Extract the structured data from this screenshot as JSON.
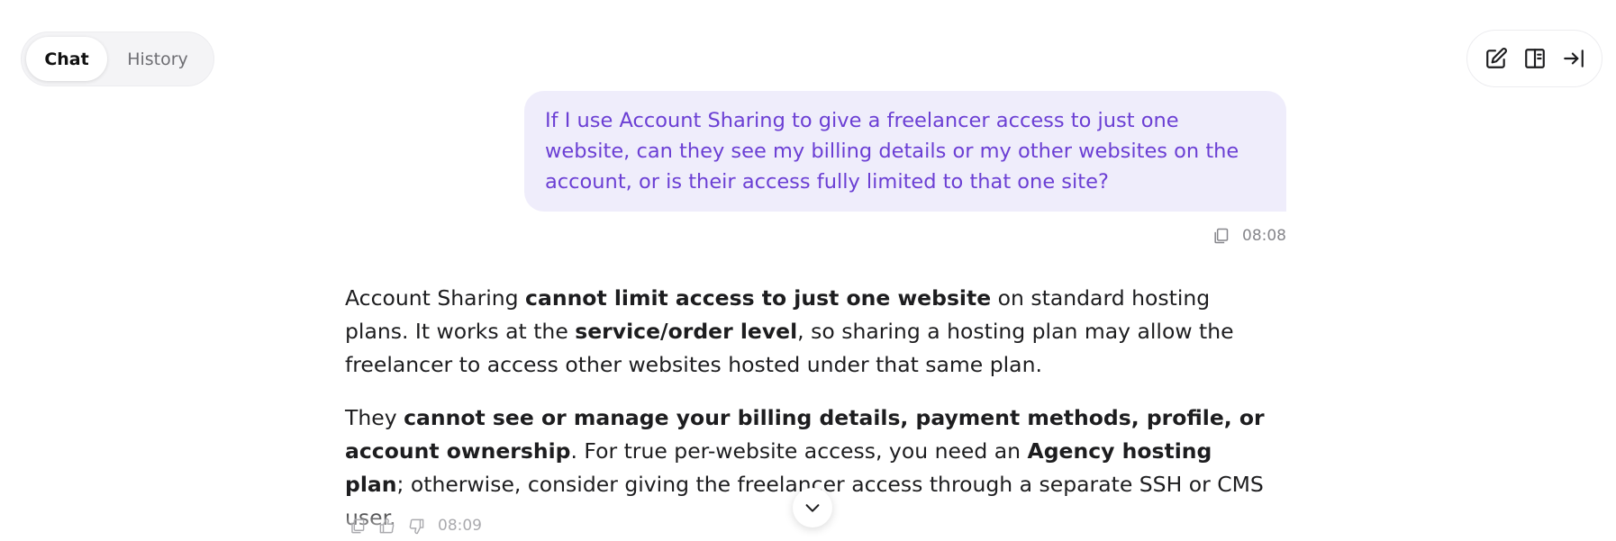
{
  "tabs": {
    "chat": "Chat",
    "history": "History"
  },
  "toolbar": {
    "icons": [
      "edit-icon",
      "side-panel-icon",
      "collapse-right-icon"
    ]
  },
  "user_message": {
    "text": "If I use Account Sharing to give a freelancer access to just one website, can they see my billing details or my other websites on the account, or is their access fully limited to that one site?",
    "time": "08:08"
  },
  "assistant_message": {
    "p1": {
      "t1": "Account Sharing ",
      "b1": "cannot limit access to just one website",
      "t2": " on standard hosting plans. It works at the ",
      "b2": "service/order level",
      "t3": ", so sharing a hosting plan may allow the freelancer to access other websites hosted under that same plan."
    },
    "p2": {
      "t1": "They ",
      "b1": "cannot see or manage your billing details, payment methods, profile, or account ownership",
      "t2": ". For true per-website access, you need an ",
      "b2": "Agency hosting plan",
      "t3": "; otherwise, consider giving the freelancer access through a separate SSH or CMS user."
    },
    "time": "08:09"
  },
  "colors": {
    "user_bubble_bg": "#efedfb",
    "user_text": "#6b3fd4"
  }
}
